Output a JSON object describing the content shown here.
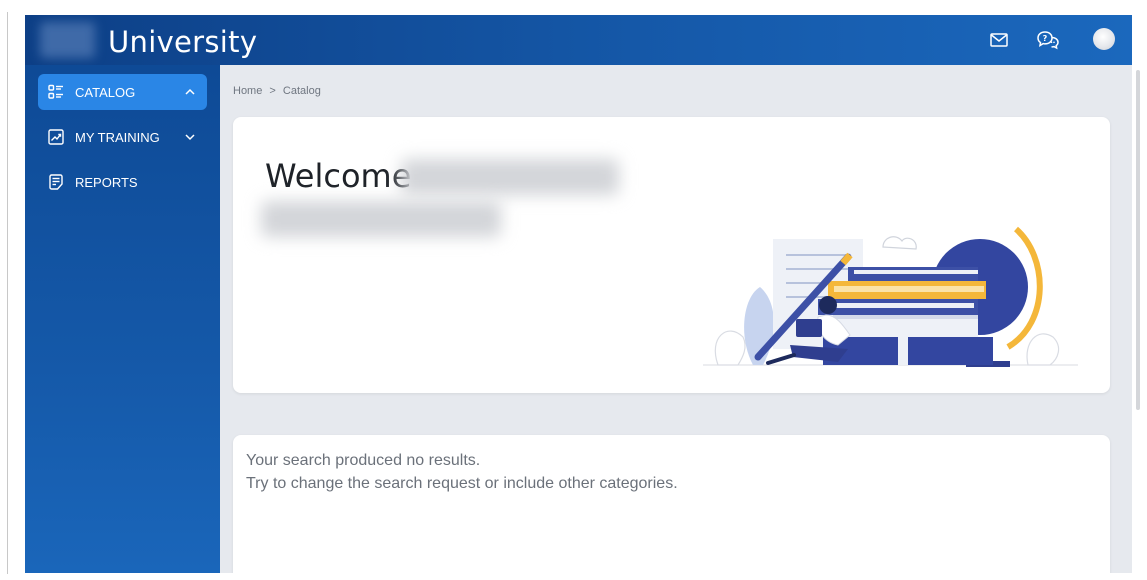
{
  "header": {
    "brand": "University",
    "icons": [
      "mail-icon",
      "help-chat-icon",
      "avatar"
    ]
  },
  "sidebar": {
    "items": [
      {
        "label": "CATALOG",
        "icon": "catalog-list-icon",
        "expanded": true,
        "active": true
      },
      {
        "label": "MY TRAINING",
        "icon": "chart-trend-icon",
        "expanded": false,
        "active": false
      },
      {
        "label": "REPORTS",
        "icon": "document-icon",
        "active": false
      }
    ]
  },
  "breadcrumb": {
    "home": "Home",
    "separator": ">",
    "current": "Catalog"
  },
  "hero": {
    "title": "Welcome"
  },
  "results": {
    "line1": "Your search produced no results.",
    "line2": "Try to change the search request or include other categories."
  },
  "colors": {
    "topbar": "#1558a8",
    "sidebar": "#1559a9",
    "active_item": "#2a86e6",
    "accent_yellow": "#f4b73a",
    "illustration_navy": "#2f3e8f"
  }
}
